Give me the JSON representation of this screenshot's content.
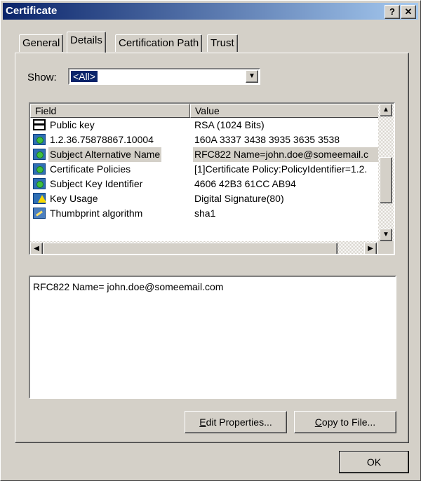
{
  "window": {
    "title": "Certificate",
    "help_glyph": "?",
    "close_glyph": "✕"
  },
  "tabs": [
    {
      "label": "General"
    },
    {
      "label": "Details",
      "active": true
    },
    {
      "label": "Certification Path"
    },
    {
      "label": "Trust"
    }
  ],
  "show": {
    "label": "Show:",
    "value": "<All>"
  },
  "list": {
    "columns": [
      "Field",
      "Value"
    ],
    "rows": [
      {
        "icon": "public-key-icon",
        "field": "Public key",
        "value": "RSA (1024 Bits)"
      },
      {
        "icon": "extension-icon",
        "field": "1.2.36.75878867.10004",
        "value": "160A 3337 3438 3935 3635 3538"
      },
      {
        "icon": "extension-icon",
        "field": "Subject Alternative Name",
        "value": "RFC822 Name=john.doe@someemail.c",
        "selected": true
      },
      {
        "icon": "extension-icon",
        "field": "Certificate Policies",
        "value": "[1]Certificate Policy:PolicyIdentifier=1.2."
      },
      {
        "icon": "extension-icon",
        "field": "Subject Key Identifier",
        "value": "4606 42B3 61CC AB94"
      },
      {
        "icon": "critical-extension-icon",
        "field": "Key Usage",
        "value": "Digital Signature(80)"
      },
      {
        "icon": "thumbprint-icon",
        "field": "Thumbprint algorithm",
        "value": "sha1"
      }
    ]
  },
  "detail": {
    "text": "RFC822 Name= john.doe@someemail.com"
  },
  "buttons": {
    "edit_properties": {
      "mnemonic": "E",
      "rest": "dit Properties..."
    },
    "copy_to_file": {
      "mnemonic": "C",
      "rest": "opy to File..."
    },
    "ok": "OK"
  }
}
